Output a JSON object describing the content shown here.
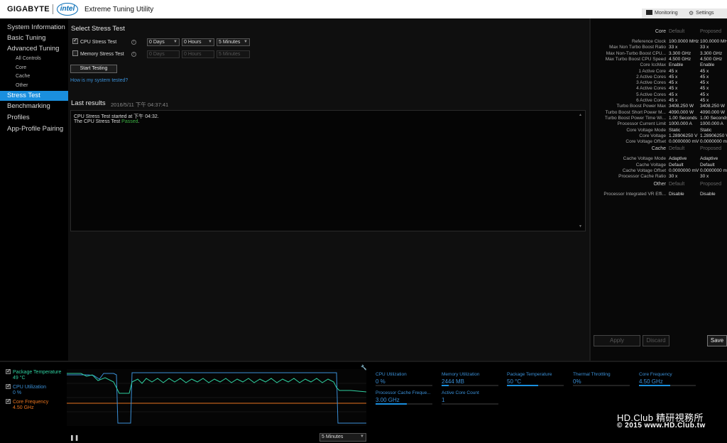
{
  "window": {
    "brand": "GIGABYTE",
    "partner": "intel",
    "title": "Extreme Tuning Utility"
  },
  "toolbar": {
    "monitoring": "Monitoring",
    "settings": "Settings"
  },
  "sidebar": {
    "items": [
      {
        "label": "System Information"
      },
      {
        "label": "Basic Tuning"
      },
      {
        "label": "Advanced Tuning"
      },
      {
        "label": "All Controls"
      },
      {
        "label": "Core"
      },
      {
        "label": "Cache"
      },
      {
        "label": "Other"
      },
      {
        "label": "Stress Test"
      },
      {
        "label": "Benchmarking"
      },
      {
        "label": "Profiles"
      },
      {
        "label": "App-Profile Pairing"
      }
    ]
  },
  "stress": {
    "title": "Select Stress Test",
    "cpu": {
      "label": "CPU Stress Test",
      "checked": true,
      "days": "0 Days",
      "hours": "0 Hours",
      "minutes": "5 Minutes"
    },
    "memory": {
      "label": "Memory Stress Test",
      "checked": false,
      "days": "0 Days",
      "hours": "0 Hours",
      "minutes": "5 Minutes"
    },
    "start_button": "Start Testing",
    "help_link": "How is my system tested?",
    "last_results_title": "Last results",
    "last_results_time": "2016/5/11 下午 04:37:41",
    "line1": "CPU Stress Test started at 下午 04:32.",
    "line2_prefix": "The CPU Stress Test ",
    "line2_status": "Passed",
    "line2_suffix": "."
  },
  "tuning": {
    "headers": {
      "section": "Core",
      "default": "Default",
      "proposed": "Proposed"
    },
    "core_rows": [
      {
        "label": "Reference Clock",
        "default": "100.0000 MHz",
        "proposed": "100.0000 MHz"
      },
      {
        "label": "Max Non Turbo Boost Ratio",
        "default": "33 x",
        "proposed": "33 x"
      },
      {
        "label": "Max Non-Turbo Boost CPU...",
        "default": "3.300 GHz",
        "proposed": "3.300 GHz"
      },
      {
        "label": "Max Turbo Boost CPU Speed",
        "default": "4.500 GHz",
        "proposed": "4.500 GHz"
      },
      {
        "label": "Core IccMax",
        "default": "Enable",
        "proposed": "Enable"
      },
      {
        "label": "1 Active Core",
        "default": "45 x",
        "proposed": "45 x"
      },
      {
        "label": "2 Active Cores",
        "default": "45 x",
        "proposed": "45 x"
      },
      {
        "label": "3 Active Cores",
        "default": "45 x",
        "proposed": "45 x"
      },
      {
        "label": "4 Active Cores",
        "default": "45 x",
        "proposed": "45 x"
      },
      {
        "label": "5 Active Cores",
        "default": "45 x",
        "proposed": "45 x"
      },
      {
        "label": "6 Active Cores",
        "default": "45 x",
        "proposed": "45 x"
      },
      {
        "label": "Turbo Boost Power Max",
        "default": "3408.250 W",
        "proposed": "3408.250 W"
      },
      {
        "label": "Turbo Boost Short Power M...",
        "default": "4090.000 W",
        "proposed": "4090.000 W"
      },
      {
        "label": "Turbo Boost Power Time Wi...",
        "default": "1.00 Seconds",
        "proposed": "1.00 Seconds"
      },
      {
        "label": "Processor Current Limit",
        "default": "1000.000 A",
        "proposed": "1000.000 A"
      },
      {
        "label": "Core Voltage Mode",
        "default": "Static",
        "proposed": "Static"
      },
      {
        "label": "Core Voltage",
        "default": "1.28906250 V",
        "proposed": "1.28906250 V"
      },
      {
        "label": "Core Voltage Offset",
        "default": "0.0000000 mV",
        "proposed": "0.0000000 mV"
      }
    ],
    "cache_section": "Cache",
    "cache_rows": [
      {
        "label": "Cache Voltage Mode",
        "default": "Adaptive",
        "proposed": "Adaptive"
      },
      {
        "label": "Cache Voltage",
        "default": "Default",
        "proposed": "Default"
      },
      {
        "label": "Cache Voltage Offset",
        "default": "0.0000000 mV",
        "proposed": "0.0000000 mV"
      },
      {
        "label": "Processor Cache Ratio",
        "default": "30 x",
        "proposed": "30 x"
      }
    ],
    "other_section": "Other",
    "other_rows": [
      {
        "label": "Processor Integrated VR Effi...",
        "default": "Disable",
        "proposed": "Disable"
      }
    ],
    "apply": "Apply",
    "discard": "Discard",
    "save": "Save"
  },
  "monitor": {
    "legend": [
      {
        "label": "Package Temperature",
        "value": "49 °C",
        "color": "#2fd0a0"
      },
      {
        "label": "CPU Utilization",
        "value": "0 %",
        "color": "#3a8fd6"
      },
      {
        "label": "Core Frequency",
        "value": "4.50 GHz",
        "color": "#e8731e"
      }
    ],
    "duration": "5 Minutes",
    "tiles": [
      {
        "label": "CPU Utilization",
        "value": "0 %",
        "fill": 0.0
      },
      {
        "label": "Memory Utilization",
        "value": "2444  MB",
        "fill": 0.12
      },
      {
        "label": "Package Temperature",
        "value": "50 °C",
        "fill": 0.55
      },
      {
        "label": "Thermal Throttling",
        "value": "0%",
        "fill": 0.0
      },
      {
        "label": "Core Frequency",
        "value": "4.50 GHz",
        "fill": 0.55
      },
      {
        "label": "Processor Cache Freque...",
        "value": "3.00 GHz",
        "fill": 0.55
      },
      {
        "label": "Active Core Count",
        "value": "1",
        "fill": 0.0
      }
    ]
  },
  "watermark": {
    "line1": "HD.Club 精研視務所",
    "line2": "© 2015  www.HD.Club.tw"
  }
}
